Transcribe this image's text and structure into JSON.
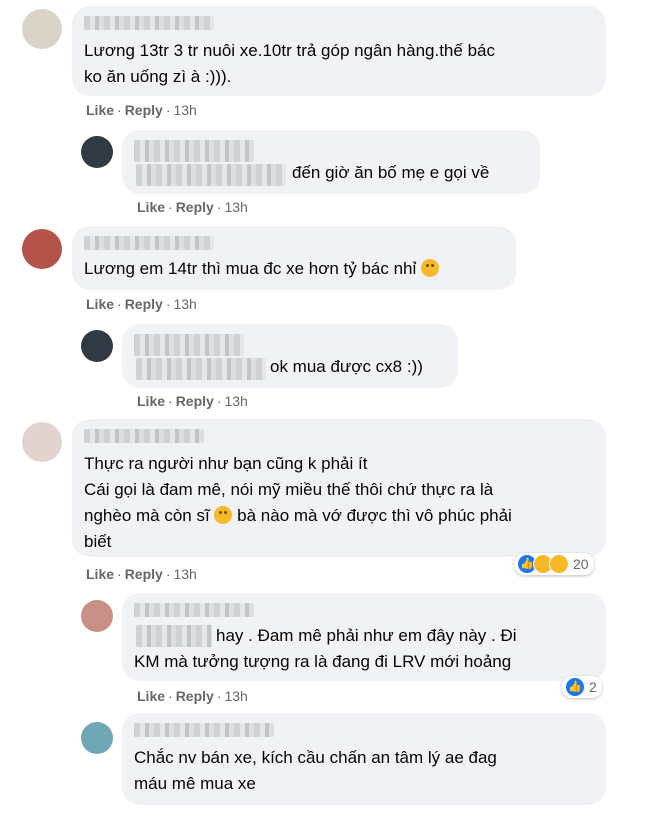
{
  "colors": {
    "bubble": "#f0f2f5",
    "meta": "#65676b",
    "like_blue": "#1877f2"
  },
  "comments": [
    {
      "text_lines": [
        "Lương 13tr 3 tr nuôi xe.10tr trả góp ngân hàng.thế bác",
        "ko ăn uống zì à :)))."
      ],
      "actions": {
        "like": "Like",
        "reply": "Reply",
        "time": "13h"
      }
    },
    {
      "text_lines": [
        "đến giờ ăn bố mẹ e gọi về"
      ],
      "actions": {
        "like": "Like",
        "reply": "Reply",
        "time": "13h"
      }
    },
    {
      "text_lines": [
        "Lương em 14tr thì mua đc xe hơn tỷ bác nhỉ"
      ],
      "emoji": "laughing-tears-emoji",
      "actions": {
        "like": "Like",
        "reply": "Reply",
        "time": "13h"
      }
    },
    {
      "text_lines": [
        "ok mua được cx8 :))"
      ],
      "actions": {
        "like": "Like",
        "reply": "Reply",
        "time": "13h"
      }
    },
    {
      "text_lines": [
        "Thực ra người như bạn cũng k phải ít",
        "Cái gọi là đam mê, nói mỹ miều thế thôi chứ thực ra là",
        "nghèo mà còn sĩ",
        "bà nào mà vớ được thì vô phúc phải",
        "biết"
      ],
      "emoji": "pensive-emoji",
      "reactions": {
        "icons": [
          "like-icon",
          "haha-icon",
          "wow-icon"
        ],
        "count": "20"
      },
      "actions": {
        "like": "Like",
        "reply": "Reply",
        "time": "13h"
      }
    },
    {
      "text_lines": [
        "hay . Đam mê phải như em đây này . Đi",
        "KM mà tưởng tượng ra là đang đi LRV mới hoảng"
      ],
      "reactions": {
        "icons": [
          "like-icon"
        ],
        "count": "2"
      },
      "actions": {
        "like": "Like",
        "reply": "Reply",
        "time": "13h"
      }
    },
    {
      "text_lines": [
        "Chắc nv bán xe, kích cầu chấn an tâm lý ae đag",
        "máu mê mua xe"
      ]
    }
  ]
}
